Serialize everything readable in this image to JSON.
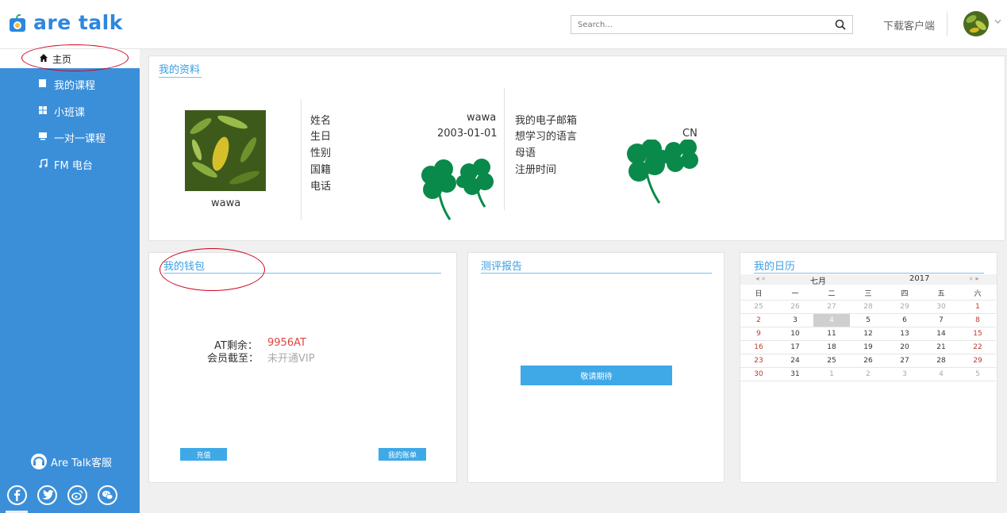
{
  "header": {
    "logo_text": "are talk",
    "search_placeholder": "Search...",
    "download_label": "下载客户端",
    "brand_color": "#2e86de"
  },
  "sidebar": {
    "items": [
      {
        "label": "主页",
        "icon": "home-icon"
      },
      {
        "label": "我的课程",
        "icon": "book-icon"
      },
      {
        "label": "小班课",
        "icon": "grid-icon"
      },
      {
        "label": "一对一课程",
        "icon": "chat-icon"
      },
      {
        "label": "FM 电台",
        "icon": "music-icon"
      }
    ],
    "service_label": "Are Talk客服",
    "socials": [
      "facebook-icon",
      "twitter-icon",
      "weibo-icon",
      "wechat-icon"
    ],
    "accent": "#3b8fd9"
  },
  "profile": {
    "title": "我的资料",
    "name": "wawa",
    "fields_left": [
      {
        "label": "姓名",
        "value": "wawa"
      },
      {
        "label": "生日",
        "value": "2003-01-01"
      },
      {
        "label": "性别",
        "value": ""
      },
      {
        "label": "国籍",
        "value": ""
      },
      {
        "label": "电话",
        "value": ""
      }
    ],
    "fields_right": [
      {
        "label": "我的电子邮箱",
        "value": ""
      },
      {
        "label": "想学习的语言",
        "value": "CN"
      },
      {
        "label": "母语",
        "value": ""
      },
      {
        "label": "注册时间",
        "value": ""
      }
    ]
  },
  "wallet": {
    "title": "我的钱包",
    "balance_label": "AT剩余：",
    "balance_value": "9956AT",
    "vip_label": "会员截至：",
    "vip_value": "未开通VIP",
    "recharge_label": "充值",
    "bill_label": "我的账单"
  },
  "report": {
    "title": "测评报告",
    "button_label": "敬请期待"
  },
  "calendar": {
    "title": "我的日历",
    "prev": "◂ «",
    "month": "七月",
    "year": "2017",
    "next": "» ▸",
    "weekdays": [
      "日",
      "一",
      "二",
      "三",
      "四",
      "五",
      "六"
    ],
    "weeks": [
      [
        "25",
        "26",
        "27",
        "28",
        "29",
        "30",
        "1"
      ],
      [
        "2",
        "3",
        "4",
        "5",
        "6",
        "7",
        "8"
      ],
      [
        "9",
        "10",
        "11",
        "12",
        "13",
        "14",
        "15"
      ],
      [
        "16",
        "17",
        "18",
        "19",
        "20",
        "21",
        "22"
      ],
      [
        "23",
        "24",
        "25",
        "26",
        "27",
        "28",
        "29"
      ],
      [
        "30",
        "31",
        "1",
        "2",
        "3",
        "4",
        "5"
      ]
    ],
    "today": "4"
  }
}
